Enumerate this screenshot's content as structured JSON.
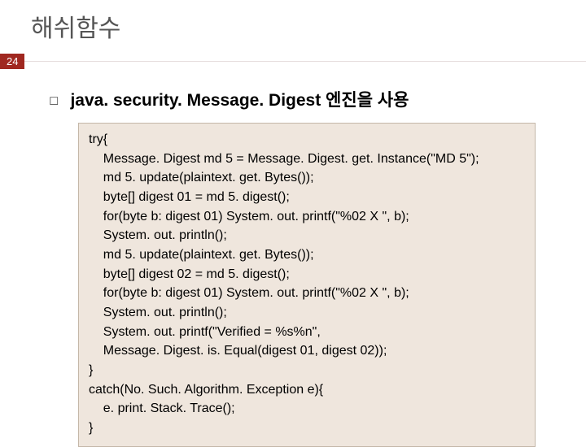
{
  "title": "해쉬함수",
  "page_number": "24",
  "heading": "java. security. Message. Digest 엔진을 사용",
  "code_lines": [
    "try{",
    "    Message. Digest md 5 = Message. Digest. get. Instance(\"MD 5\");",
    "    md 5. update(plaintext. get. Bytes());",
    "    byte[] digest 01 = md 5. digest();",
    "    for(byte b: digest 01) System. out. printf(\"%02 X \", b);",
    "    System. out. println();",
    "    md 5. update(plaintext. get. Bytes());",
    "    byte[] digest 02 = md 5. digest();",
    "    for(byte b: digest 01) System. out. printf(\"%02 X \", b);",
    "    System. out. println();",
    "    System. out. printf(\"Verified = %s%n\",",
    "    Message. Digest. is. Equal(digest 01, digest 02));",
    "}",
    "catch(No. Such. Algorithm. Exception e){",
    "    e. print. Stack. Trace();",
    "}"
  ]
}
